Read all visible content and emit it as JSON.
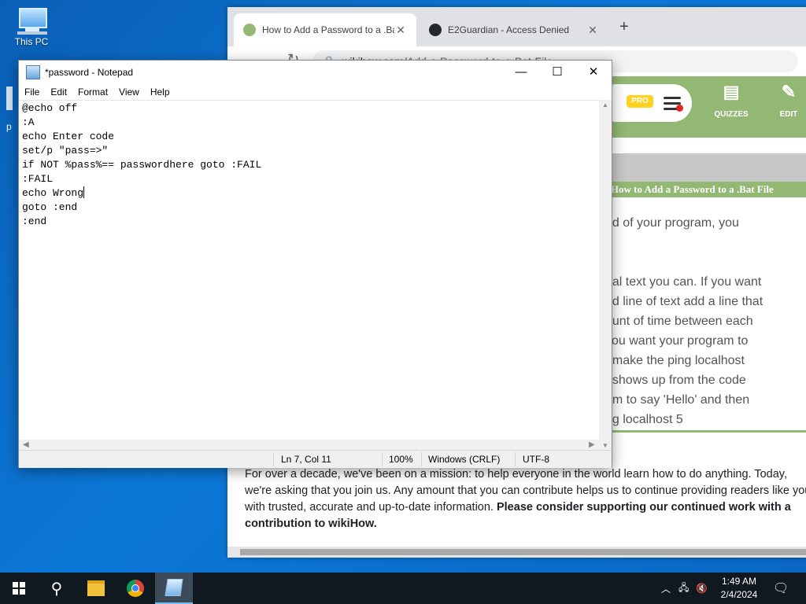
{
  "desktop": {
    "icons": [
      {
        "label": "This PC",
        "icon": "this-pc-icon"
      }
    ],
    "partial_icon_label": "p"
  },
  "browser": {
    "tabs": [
      {
        "title": "How to Add a Password to a .Bat",
        "icon": "wikihow-favicon",
        "active": true
      },
      {
        "title": "E2Guardian - Access Denied",
        "icon": "github-icon",
        "active": false
      }
    ],
    "address": {
      "host": "wikihow.com",
      "path": "/Add-a-Password-to-a-Bat-File"
    },
    "site": {
      "pro_badge": "PRO",
      "buttons": [
        {
          "label": "QUIZZES",
          "icon": "quizzes-icon"
        },
        {
          "label": "EDIT",
          "icon": "pencil-icon"
        }
      ],
      "title_band": "i How to Add a Password to a .Bat File",
      "article_lines": [
        "nd of your program, you",
        "",
        "",
        "nal text you can. If you want",
        "nd line of text add a line that",
        "ount of time between each",
        "you want your program to",
        ", make the ping localhost",
        "t shows up from the code",
        "am to say 'Hello' and then",
        "ng localhost 5"
      ],
      "support_text": "For over a decade, we've been on a mission: to help everyone in the world learn how to do anything. Today, we're asking that you join us. Any amount that you can contribute helps us to continue providing readers like you with trusted, accurate and up-to-date information.",
      "support_bold": "Please consider supporting our continued work with a contribution to wikiHow."
    }
  },
  "notepad": {
    "title": "*password - Notepad",
    "menu": [
      "File",
      "Edit",
      "Format",
      "View",
      "Help"
    ],
    "lines_before_caret": "@echo off\n:A\necho Enter code\nset/p \"pass=>\"\nif NOT %pass%== passwordhere goto :FAIL\n:FAIL\necho Wrong",
    "lines_after_caret": "\ngoto :end\n:end",
    "status": {
      "position": "Ln 7, Col 11",
      "zoom": "100%",
      "line_ending": "Windows (CRLF)",
      "encoding": "UTF-8"
    }
  },
  "taskbar": {
    "apps": [
      "start-button",
      "search-icon",
      "file-explorer-icon",
      "chrome-icon",
      "notepad-icon"
    ],
    "clock": {
      "time": "1:49 AM",
      "date": "2/4/2024"
    }
  }
}
